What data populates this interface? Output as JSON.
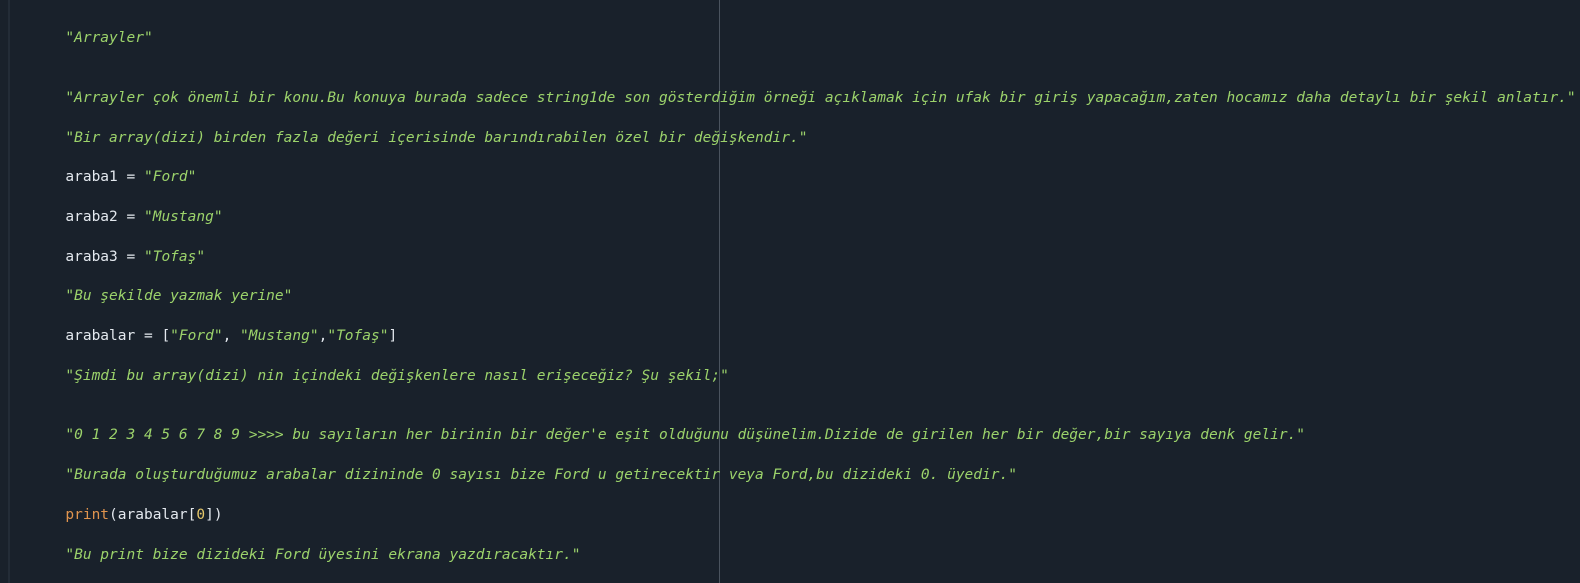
{
  "lines": [
    {
      "string": "\"Arrayler\""
    },
    {
      "string": "\"Arrayler çok önemli bir konu.Bu konuya burada sadece string1de son gösterdiğim örneği açıklamak için ufak bir giriş yapacağım,zaten hocamız daha detaylı bir şekil anlatır.\""
    },
    {
      "string": "\"Bir array(dizi) birden fazla değeri içerisinde barındırabilen özel bir değişkendir.\""
    },
    {
      "name": "araba1",
      "op": " = ",
      "value": "\"Ford\""
    },
    {
      "name": "araba2",
      "op": " = ",
      "value": "\"Mustang\""
    },
    {
      "name": "araba3",
      "op": " = ",
      "value": "\"Tofaş\""
    },
    {
      "string": "\"Bu şekilde yazmak yerine\""
    },
    {
      "name": "arabalar",
      "op": " = ",
      "open": "[",
      "items": [
        "\"Ford\"",
        "\"Mustang\"",
        "\"Tofaş\""
      ],
      "sep1": ", ",
      "sep2": ",",
      "close": "]"
    },
    {
      "string": "\"Şimdi bu array(dizi) nin içindeki değişkenlere nasıl erişeceğiz? Şu şekil;\""
    },
    {
      "string": "\"0 1 2 3 4 5 6 7 8 9 >>>> bu sayıların her birinin bir değer'e eşit olduğunu düşünelim.Dizide de girilen her bir değer,bir sayıya denk gelir.\""
    },
    {
      "string": "\"Burada oluşturduğumuz arabalar dizininde 0 sayısı bize Ford u getirecektir veya Ford,bu dizideki 0. üyedir.\""
    },
    {
      "func": "print",
      "open": "(",
      "arg": "arabalar",
      "index_open": "[",
      "index": "0",
      "index_close": "]",
      "close": ")"
    },
    {
      "string": "\"Bu print bize dizideki Ford üyesini ekrana yazdıracaktır.\""
    }
  ],
  "colors": {
    "background": "#19212b",
    "string": "#9cd36b",
    "text": "#e3e8ee",
    "function": "#e0944e",
    "number": "#e6c86a",
    "ruler": "#4a535e"
  }
}
